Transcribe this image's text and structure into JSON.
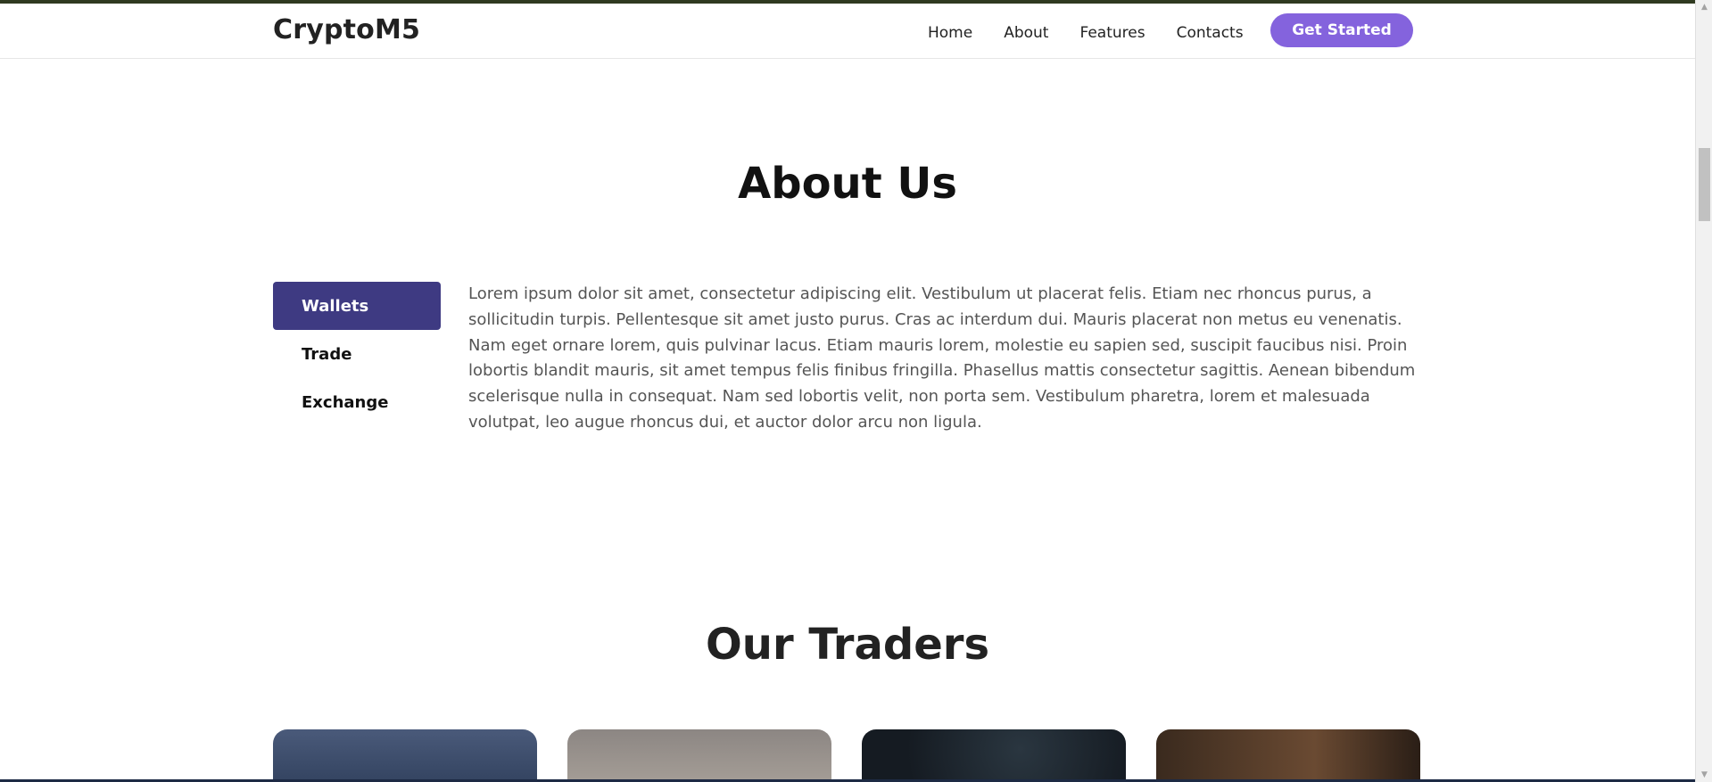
{
  "header": {
    "brand": "CryptoM5",
    "nav": [
      "Home",
      "About",
      "Features",
      "Contacts"
    ],
    "cta_label": "Get Started"
  },
  "about": {
    "title": "About Us",
    "tabs": [
      "Wallets",
      "Trade",
      "Exchange"
    ],
    "active_tab": "Wallets",
    "text": "Lorem ipsum dolor sit amet, consectetur adipiscing elit. Vestibulum ut placerat felis. Etiam nec rhoncus purus, a sollicitudin turpis. Pellentesque sit amet justo purus. Cras ac interdum dui. Mauris placerat non metus eu venenatis. Nam eget ornare lorem, quis pulvinar lacus. Etiam mauris lorem, molestie eu sapien sed, suscipit faucibus nisi. Proin lobortis blandit mauris, sit amet tempus felis finibus fringilla. Phasellus mattis consectetur sagittis. Aenean bibendum scelerisque nulla in consequat. Nam sed lobortis velit, non porta sem. Vestibulum pharetra, lorem et malesuada volutpat, leo augue rhoncus dui, et auctor dolor arcu non ligula."
  },
  "traders": {
    "title": "Our Traders"
  },
  "colors": {
    "accent": "#8463dd",
    "tab_active": "#3e3a82"
  }
}
